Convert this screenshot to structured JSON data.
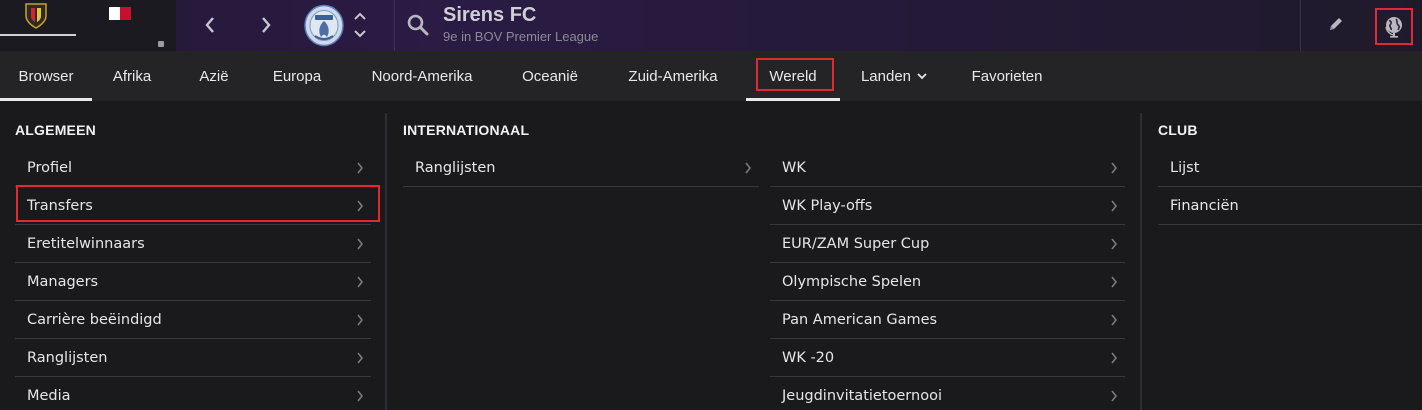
{
  "header": {
    "club_name": "Sirens FC",
    "club_subtitle": "9e in BOV Premier League",
    "colors": {
      "accent_red": "#e02a2f",
      "header_purple": "#2b1b45",
      "text": "#e8e8ea"
    }
  },
  "tabs": [
    {
      "label": "Browser",
      "active": true
    },
    {
      "label": "Afrika"
    },
    {
      "label": "Azië"
    },
    {
      "label": "Europa"
    },
    {
      "label": "Noord-Amerika"
    },
    {
      "label": "Oceanië"
    },
    {
      "label": "Zuid-Amerika"
    },
    {
      "label": "Wereld",
      "highlighted": true
    },
    {
      "label": "Landen",
      "dropdown": true
    },
    {
      "label": "Favorieten"
    }
  ],
  "sections": {
    "algemeen": {
      "title": "ALGEMEEN",
      "items": [
        "Profiel",
        "Transfers",
        "Eretitelwinnaars",
        "Managers",
        "Carrière beëindigd",
        "Ranglijsten",
        "Media"
      ]
    },
    "internationaal": {
      "title": "INTERNATIONAAL",
      "left_items": [
        "Ranglijsten"
      ],
      "right_items": [
        "WK",
        "WK Play-offs",
        "EUR/ZAM Super Cup",
        "Olympische Spelen",
        "Pan American Games",
        "WK -20",
        "Jeugdinvitatietoernooi"
      ]
    },
    "club": {
      "title": "CLUB",
      "items": [
        "Lijst",
        "Financiën"
      ]
    }
  },
  "icons": {
    "back": "chevron-left-icon",
    "forward": "chevron-right-icon",
    "search": "search-icon",
    "edit": "pencil-icon",
    "world": "globe-icon"
  }
}
